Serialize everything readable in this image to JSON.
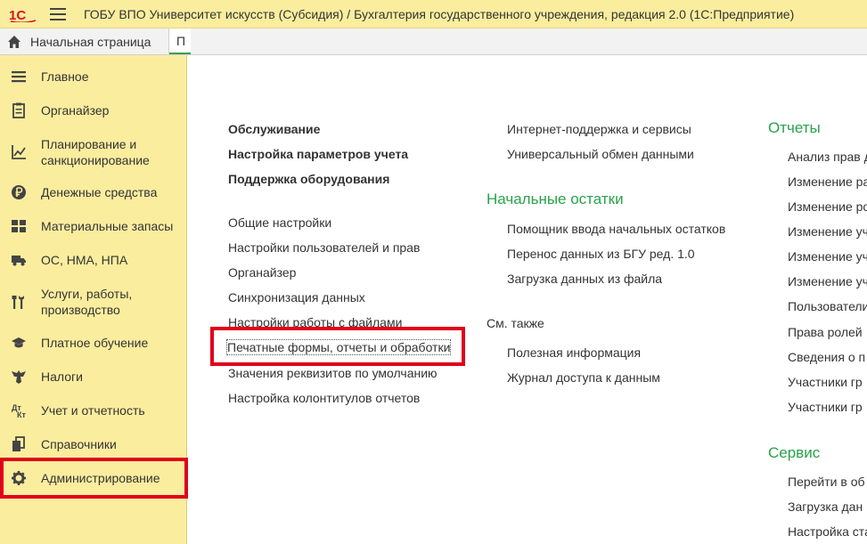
{
  "window": {
    "title": "ГОБУ ВПО Университет искусств (Субсидия) / Бухгалтерия государственного учреждения, редакция 2.0  (1С:Предприятие)"
  },
  "tabs": {
    "home_label": "Начальная страница",
    "current_label": "П"
  },
  "sidebar": {
    "items": [
      {
        "label": "Главное",
        "icon": "menu-icon"
      },
      {
        "label": "Органайзер",
        "icon": "notepad-icon"
      },
      {
        "label": "Планирование и\nсанкционирование",
        "icon": "chart-icon"
      },
      {
        "label": "Денежные средства",
        "icon": "ruble-icon"
      },
      {
        "label": "Материальные запасы",
        "icon": "grid-icon"
      },
      {
        "label": "ОС, НМА, НПА",
        "icon": "truck-icon"
      },
      {
        "label": "Услуги, работы,\nпроизводство",
        "icon": "tools-icon"
      },
      {
        "label": "Платное обучение",
        "icon": "graduation-cap-icon"
      },
      {
        "label": "Налоги",
        "icon": "eagle-icon"
      },
      {
        "label": "Учет и отчетность",
        "icon": "report-icon"
      },
      {
        "label": "Справочники",
        "icon": "books-icon"
      },
      {
        "label": "Администрирование",
        "icon": "gear-icon"
      }
    ]
  },
  "col1": {
    "bold_links": [
      "Обслуживание",
      "Настройка параметров учета",
      "Поддержка оборудования"
    ],
    "links": [
      "Общие настройки",
      "Настройки пользователей и прав",
      "Органайзер",
      "Синхронизация данных",
      "Настройки работы с файлами",
      "Печатные формы, отчеты и обработки",
      "Значения реквизитов по умолчанию",
      "Настройка колонтитулов отчетов"
    ]
  },
  "col2": {
    "top_links": [
      "Интернет-поддержка и сервисы",
      "Универсальный обмен данными"
    ],
    "section_initial": "Начальные остатки",
    "initial_links": [
      "Помощник ввода начальных остатков",
      "Перенос данных из БГУ ред. 1.0",
      "Загрузка данных из файла"
    ],
    "see_also": "См. также",
    "see_also_links": [
      "Полезная информация",
      "Журнал доступа к данным"
    ]
  },
  "col3": {
    "section_reports": "Отчеты",
    "report_links": [
      "Анализ прав д",
      "Изменение ра",
      "Изменение ро",
      "Изменение уч",
      "Изменение уч",
      "Изменение уч",
      "Пользователи",
      "Права ролей",
      "Сведения о п",
      "Участники гр",
      "Участники гр"
    ],
    "section_service": "Сервис",
    "service_links": [
      "Перейти в об",
      "Загрузка дан",
      "Настройка ста"
    ]
  },
  "colors": {
    "panel_yellow": "#fbed9e",
    "section_green": "#27a24a",
    "highlight_red": "#e0001b"
  }
}
